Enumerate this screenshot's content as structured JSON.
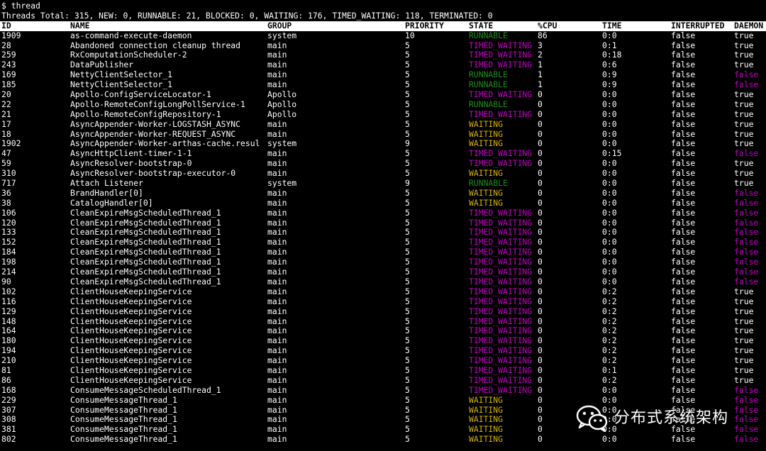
{
  "prompt_line": "$ thread",
  "summary_line": "Threads Total: 315, NEW: 0, RUNNABLE: 21, BLOCKED: 0, WAITING: 176, TIMED_WAITING: 118, TERMINATED: 0",
  "columns": {
    "id": "ID",
    "name": "NAME",
    "group": "GROUP",
    "priority": "PRIORITY",
    "state": "STATE",
    "cpu": "%CPU",
    "time": "TIME",
    "interrupted": "INTERRUPTED",
    "daemon": "DAEMON"
  },
  "colors": {
    "background": "#000000",
    "text": "#ffffff",
    "header_bg": "#ffffff",
    "header_text": "#000000",
    "runnable": "#1f8a1f",
    "timed_waiting": "#c000c0",
    "waiting": "#d4b000",
    "daemon_false": "#c000c0"
  },
  "rows": [
    {
      "id": "1909",
      "name": "as-command-execute-daemon",
      "group": "system",
      "priority": "10",
      "state": "RUNNABLE",
      "cpu": "86",
      "time": "0:0",
      "interrupted": "false",
      "daemon": "true"
    },
    {
      "id": "28",
      "name": "Abandoned connection cleanup thread",
      "group": "main",
      "priority": "5",
      "state": "TIMED_WAITING",
      "cpu": "3",
      "time": "0:1",
      "interrupted": "false",
      "daemon": "true"
    },
    {
      "id": "259",
      "name": "RxComputationScheduler-2",
      "group": "main",
      "priority": "5",
      "state": "TIMED_WAITING",
      "cpu": "2",
      "time": "0:18",
      "interrupted": "false",
      "daemon": "true"
    },
    {
      "id": "243",
      "name": "DataPublisher",
      "group": "main",
      "priority": "5",
      "state": "TIMED_WAITING",
      "cpu": "1",
      "time": "0:6",
      "interrupted": "false",
      "daemon": "true"
    },
    {
      "id": "169",
      "name": "NettyClientSelector_1",
      "group": "main",
      "priority": "5",
      "state": "RUNNABLE",
      "cpu": "1",
      "time": "0:9",
      "interrupted": "false",
      "daemon": "false"
    },
    {
      "id": "185",
      "name": "NettyClientSelector_1",
      "group": "main",
      "priority": "5",
      "state": "RUNNABLE",
      "cpu": "1",
      "time": "0:9",
      "interrupted": "false",
      "daemon": "false"
    },
    {
      "id": "20",
      "name": "Apollo-ConfigServiceLocator-1",
      "group": "Apollo",
      "priority": "5",
      "state": "TIMED_WAITING",
      "cpu": "0",
      "time": "0:0",
      "interrupted": "false",
      "daemon": "true"
    },
    {
      "id": "22",
      "name": "Apollo-RemoteConfigLongPollService-1",
      "group": "Apollo",
      "priority": "5",
      "state": "RUNNABLE",
      "cpu": "0",
      "time": "0:0",
      "interrupted": "false",
      "daemon": "true"
    },
    {
      "id": "21",
      "name": "Apollo-RemoteConfigRepository-1",
      "group": "Apollo",
      "priority": "5",
      "state": "TIMED_WAITING",
      "cpu": "0",
      "time": "0:0",
      "interrupted": "false",
      "daemon": "true"
    },
    {
      "id": "17",
      "name": "AsyncAppender-Worker-LOGSTASH_ASYNC",
      "group": "main",
      "priority": "5",
      "state": "WAITING",
      "cpu": "0",
      "time": "0:0",
      "interrupted": "false",
      "daemon": "true"
    },
    {
      "id": "18",
      "name": "AsyncAppender-Worker-REQUEST_ASYNC",
      "group": "main",
      "priority": "5",
      "state": "WAITING",
      "cpu": "0",
      "time": "0:0",
      "interrupted": "false",
      "daemon": "true"
    },
    {
      "id": "1902",
      "name": "AsyncAppender-Worker-arthas-cache.resul",
      "group": "system",
      "priority": "9",
      "state": "WAITING",
      "cpu": "0",
      "time": "0:0",
      "interrupted": "false",
      "daemon": "true"
    },
    {
      "id": "47",
      "name": "AsyncHttpClient-timer-1-1",
      "group": "main",
      "priority": "5",
      "state": "TIMED_WAITING",
      "cpu": "0",
      "time": "0:15",
      "interrupted": "false",
      "daemon": "false"
    },
    {
      "id": "59",
      "name": "AsyncResolver-bootstrap-0",
      "group": "main",
      "priority": "5",
      "state": "TIMED_WAITING",
      "cpu": "0",
      "time": "0:0",
      "interrupted": "false",
      "daemon": "true"
    },
    {
      "id": "310",
      "name": "AsyncResolver-bootstrap-executor-0",
      "group": "main",
      "priority": "5",
      "state": "WAITING",
      "cpu": "0",
      "time": "0:0",
      "interrupted": "false",
      "daemon": "true"
    },
    {
      "id": "717",
      "name": "Attach Listener",
      "group": "system",
      "priority": "9",
      "state": "RUNNABLE",
      "cpu": "0",
      "time": "0:0",
      "interrupted": "false",
      "daemon": "true"
    },
    {
      "id": "36",
      "name": "BrandHandler[0]",
      "group": "main",
      "priority": "5",
      "state": "WAITING",
      "cpu": "0",
      "time": "0:0",
      "interrupted": "false",
      "daemon": "false"
    },
    {
      "id": "38",
      "name": "CatalogHandler[0]",
      "group": "main",
      "priority": "5",
      "state": "WAITING",
      "cpu": "0",
      "time": "0:0",
      "interrupted": "false",
      "daemon": "false"
    },
    {
      "id": "106",
      "name": "CleanExpireMsgScheduledThread_1",
      "group": "main",
      "priority": "5",
      "state": "TIMED_WAITING",
      "cpu": "0",
      "time": "0:0",
      "interrupted": "false",
      "daemon": "false"
    },
    {
      "id": "120",
      "name": "CleanExpireMsgScheduledThread_1",
      "group": "main",
      "priority": "5",
      "state": "TIMED_WAITING",
      "cpu": "0",
      "time": "0:0",
      "interrupted": "false",
      "daemon": "false"
    },
    {
      "id": "133",
      "name": "CleanExpireMsgScheduledThread_1",
      "group": "main",
      "priority": "5",
      "state": "TIMED_WAITING",
      "cpu": "0",
      "time": "0:0",
      "interrupted": "false",
      "daemon": "false"
    },
    {
      "id": "152",
      "name": "CleanExpireMsgScheduledThread_1",
      "group": "main",
      "priority": "5",
      "state": "TIMED_WAITING",
      "cpu": "0",
      "time": "0:0",
      "interrupted": "false",
      "daemon": "false"
    },
    {
      "id": "184",
      "name": "CleanExpireMsgScheduledThread_1",
      "group": "main",
      "priority": "5",
      "state": "TIMED_WAITING",
      "cpu": "0",
      "time": "0:0",
      "interrupted": "false",
      "daemon": "false"
    },
    {
      "id": "198",
      "name": "CleanExpireMsgScheduledThread_1",
      "group": "main",
      "priority": "5",
      "state": "TIMED_WAITING",
      "cpu": "0",
      "time": "0:0",
      "interrupted": "false",
      "daemon": "false"
    },
    {
      "id": "214",
      "name": "CleanExpireMsgScheduledThread_1",
      "group": "main",
      "priority": "5",
      "state": "TIMED_WAITING",
      "cpu": "0",
      "time": "0:0",
      "interrupted": "false",
      "daemon": "false"
    },
    {
      "id": "90",
      "name": "CleanExpireMsgScheduledThread_1",
      "group": "main",
      "priority": "5",
      "state": "TIMED_WAITING",
      "cpu": "0",
      "time": "0:0",
      "interrupted": "false",
      "daemon": "false"
    },
    {
      "id": "102",
      "name": "ClientHouseKeepingService",
      "group": "main",
      "priority": "5",
      "state": "TIMED_WAITING",
      "cpu": "0",
      "time": "0:2",
      "interrupted": "false",
      "daemon": "true"
    },
    {
      "id": "116",
      "name": "ClientHouseKeepingService",
      "group": "main",
      "priority": "5",
      "state": "TIMED_WAITING",
      "cpu": "0",
      "time": "0:2",
      "interrupted": "false",
      "daemon": "true"
    },
    {
      "id": "129",
      "name": "ClientHouseKeepingService",
      "group": "main",
      "priority": "5",
      "state": "TIMED_WAITING",
      "cpu": "0",
      "time": "0:2",
      "interrupted": "false",
      "daemon": "true"
    },
    {
      "id": "148",
      "name": "ClientHouseKeepingService",
      "group": "main",
      "priority": "5",
      "state": "TIMED_WAITING",
      "cpu": "0",
      "time": "0:2",
      "interrupted": "false",
      "daemon": "true"
    },
    {
      "id": "164",
      "name": "ClientHouseKeepingService",
      "group": "main",
      "priority": "5",
      "state": "TIMED_WAITING",
      "cpu": "0",
      "time": "0:2",
      "interrupted": "false",
      "daemon": "true"
    },
    {
      "id": "180",
      "name": "ClientHouseKeepingService",
      "group": "main",
      "priority": "5",
      "state": "TIMED_WAITING",
      "cpu": "0",
      "time": "0:2",
      "interrupted": "false",
      "daemon": "true"
    },
    {
      "id": "194",
      "name": "ClientHouseKeepingService",
      "group": "main",
      "priority": "5",
      "state": "TIMED_WAITING",
      "cpu": "0",
      "time": "0:2",
      "interrupted": "false",
      "daemon": "true"
    },
    {
      "id": "210",
      "name": "ClientHouseKeepingService",
      "group": "main",
      "priority": "5",
      "state": "TIMED_WAITING",
      "cpu": "0",
      "time": "0:2",
      "interrupted": "false",
      "daemon": "true"
    },
    {
      "id": "81",
      "name": "ClientHouseKeepingService",
      "group": "main",
      "priority": "5",
      "state": "TIMED_WAITING",
      "cpu": "0",
      "time": "0:1",
      "interrupted": "false",
      "daemon": "true"
    },
    {
      "id": "86",
      "name": "ClientHouseKeepingService",
      "group": "main",
      "priority": "5",
      "state": "TIMED_WAITING",
      "cpu": "0",
      "time": "0:2",
      "interrupted": "false",
      "daemon": "true"
    },
    {
      "id": "168",
      "name": "ConsumeMessageScheduledThread_1",
      "group": "main",
      "priority": "5",
      "state": "TIMED_WAITING",
      "cpu": "0",
      "time": "0:0",
      "interrupted": "false",
      "daemon": "false"
    },
    {
      "id": "229",
      "name": "ConsumeMessageThread_1",
      "group": "main",
      "priority": "5",
      "state": "WAITING",
      "cpu": "0",
      "time": "0:0",
      "interrupted": "false",
      "daemon": "false"
    },
    {
      "id": "307",
      "name": "ConsumeMessageThread_1",
      "group": "main",
      "priority": "5",
      "state": "WAITING",
      "cpu": "0",
      "time": "0:0",
      "interrupted": "false",
      "daemon": "false"
    },
    {
      "id": "308",
      "name": "ConsumeMessageThread_1",
      "group": "main",
      "priority": "5",
      "state": "WAITING",
      "cpu": "0",
      "time": "0:0",
      "interrupted": "false",
      "daemon": "false"
    },
    {
      "id": "381",
      "name": "ConsumeMessageThread_1",
      "group": "main",
      "priority": "5",
      "state": "WAITING",
      "cpu": "0",
      "time": "0:0",
      "interrupted": "false",
      "daemon": "false"
    },
    {
      "id": "802",
      "name": "ConsumeMessageThread_1",
      "group": "main",
      "priority": "5",
      "state": "WAITING",
      "cpu": "0",
      "time": "0:0",
      "interrupted": "false",
      "daemon": "false"
    }
  ],
  "watermark": {
    "icon": "wechat-icon",
    "text": "分布式系统架构"
  }
}
